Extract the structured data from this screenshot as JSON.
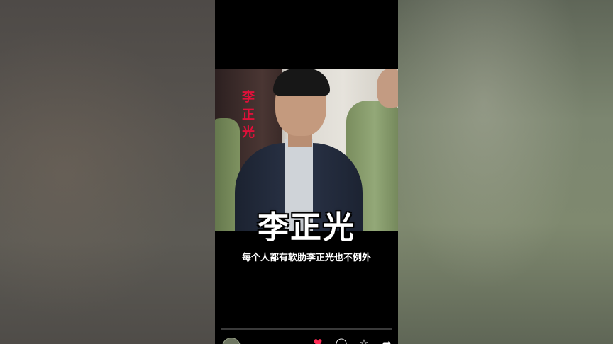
{
  "video": {
    "side_label_chars": [
      "李",
      "正",
      "光"
    ],
    "title_overlay": "李正光",
    "subtitle": "每个人都有软肋李正光也不例外",
    "progress_fraction": 0.0
  },
  "actions": {
    "like_icon": "heart-icon",
    "comment_icon": "comment-icon",
    "favorite_icon": "star-icon",
    "share_icon": "share-icon"
  },
  "colors": {
    "like": "#ff2c55",
    "side_label": "#e0103a",
    "background": "#000000"
  }
}
